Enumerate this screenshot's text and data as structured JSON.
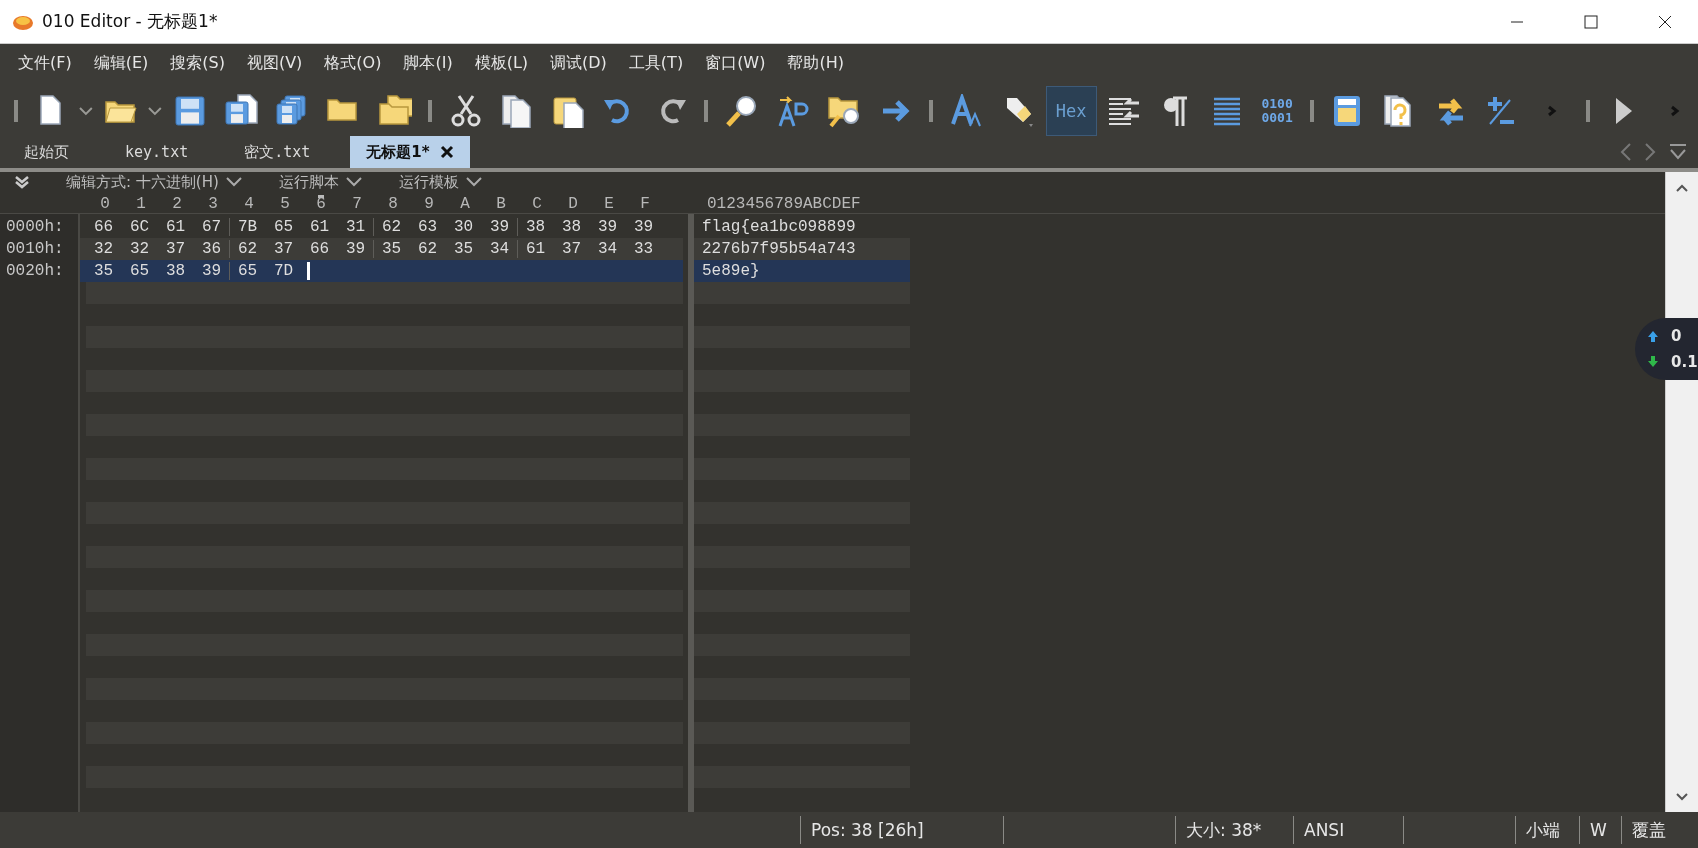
{
  "window": {
    "title": "010 Editor - 无标题1*"
  },
  "menu": [
    {
      "label": "文件(F)"
    },
    {
      "label": "编辑(E)"
    },
    {
      "label": "搜索(S)"
    },
    {
      "label": "视图(V)"
    },
    {
      "label": "格式(O)"
    },
    {
      "label": "脚本(I)"
    },
    {
      "label": "模板(L)"
    },
    {
      "label": "调试(D)"
    },
    {
      "label": "工具(T)"
    },
    {
      "label": "窗口(W)"
    },
    {
      "label": "帮助(H)"
    }
  ],
  "toolbar": {
    "hex_button": {
      "label": "Hex",
      "selected": true
    },
    "binary_button": {
      "lines": [
        "0100",
        "0001"
      ]
    }
  },
  "tabs": [
    {
      "label": "起始页",
      "selected": false
    },
    {
      "label": "key.txt",
      "selected": false
    },
    {
      "label": "密文.txt",
      "selected": false
    },
    {
      "label": "无标题1*",
      "selected": true
    }
  ],
  "editor_bar": [
    {
      "label": "编辑方式: 十六进制(H)"
    },
    {
      "label": "运行脚本"
    },
    {
      "label": "运行模板"
    }
  ],
  "hex_columns": [
    {
      "label": "0",
      "marked": false
    },
    {
      "label": "1",
      "marked": false
    },
    {
      "label": "2",
      "marked": false
    },
    {
      "label": "3",
      "marked": false
    },
    {
      "label": "4",
      "marked": false
    },
    {
      "label": "5",
      "marked": false
    },
    {
      "label": "6",
      "marked": true
    },
    {
      "label": "7",
      "marked": false
    },
    {
      "label": "8",
      "marked": false
    },
    {
      "label": "9",
      "marked": false
    },
    {
      "label": "A",
      "marked": false
    },
    {
      "label": "B",
      "marked": false
    },
    {
      "label": "C",
      "marked": false
    },
    {
      "label": "D",
      "marked": false
    },
    {
      "label": "E",
      "marked": false
    },
    {
      "label": "F",
      "marked": false
    }
  ],
  "text_header": "0123456789ABCDEF",
  "rows": [
    {
      "offset": "0000h:",
      "bytes": [
        "66",
        "6C",
        "61",
        "67",
        "7B",
        "65",
        "61",
        "31",
        "62",
        "63",
        "30",
        "39",
        "38",
        "38",
        "39",
        "39"
      ],
      "text": "flag{ea1bc098899",
      "selected": false,
      "cursor": false
    },
    {
      "offset": "0010h:",
      "bytes": [
        "32",
        "32",
        "37",
        "36",
        "62",
        "37",
        "66",
        "39",
        "35",
        "62",
        "35",
        "34",
        "61",
        "37",
        "34",
        "33"
      ],
      "text": "2276b7f95b54a743",
      "selected": false,
      "cursor": false
    },
    {
      "offset": "0020h:",
      "bytes": [
        "35",
        "65",
        "38",
        "39",
        "65",
        "7D"
      ],
      "text": "5e89e}",
      "selected": true,
      "cursor": true
    }
  ],
  "status_bar": [
    {
      "text": "Pos: 38 [26h]"
    },
    {
      "text": "大小: 38*"
    },
    {
      "text": "ANSI"
    },
    {
      "text": "小端"
    },
    {
      "text": "W"
    },
    {
      "text": "覆盖"
    }
  ],
  "net_widget": {
    "up": "0",
    "down": "0.1"
  }
}
